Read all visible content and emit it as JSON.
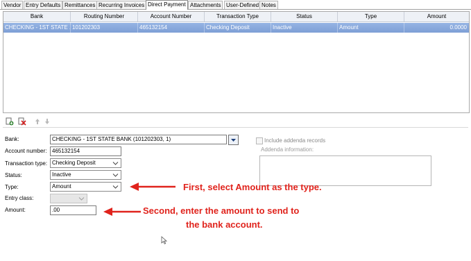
{
  "tabs": [
    {
      "label": "Vendor"
    },
    {
      "label": "Entry Defaults"
    },
    {
      "label": "Remittances"
    },
    {
      "label": "Recurring Invoices"
    },
    {
      "label": "Direct Payment"
    },
    {
      "label": "Attachments"
    },
    {
      "label": "User-Defined"
    },
    {
      "label": "Notes"
    }
  ],
  "active_tab": "Direct Payment",
  "grid": {
    "columns": [
      "Bank",
      "Routing Number",
      "Account Number",
      "Transaction Type",
      "Status",
      "Type",
      "Amount"
    ],
    "rows": [
      {
        "bank": "CHECKING - 1ST STATE ...",
        "routing": "101202303",
        "account": "465132154",
        "transaction_type": "Checking Deposit",
        "status": "Inactive",
        "type": "Amount",
        "amount": "0.0000"
      }
    ]
  },
  "toolbar": {
    "icons": [
      "add-record-icon",
      "delete-record-icon",
      "move-up-icon",
      "move-down-icon"
    ]
  },
  "form": {
    "bank_label": "Bank:",
    "bank_value": "CHECKING - 1ST STATE BANK (101202303, 1)",
    "account_label": "Account number:",
    "account_value": "465132154",
    "transaction_type_label": "Transaction type:",
    "transaction_type_value": "Checking Deposit",
    "status_label": "Status:",
    "status_value": "Inactive",
    "type_label": "Type:",
    "type_value": "Amount",
    "entry_class_label": "Entry class:",
    "entry_class_value": "",
    "amount_label": "Amount:",
    "amount_value": ".00",
    "include_addenda_label": "Include addenda records",
    "addenda_info_label": "Addenda information:",
    "addenda_info_value": ""
  },
  "annotations": {
    "first": "First, select Amount as the type.",
    "second_line1": "Second, enter the amount to send to",
    "second_line2": "the bank account."
  },
  "colors": {
    "selection": "#89a9dd",
    "annotation": "#e0231c"
  }
}
